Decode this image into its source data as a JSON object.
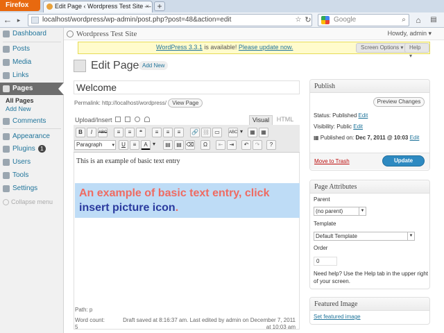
{
  "browser": {
    "firefox_label": "Firefox",
    "tab_title": "Edit Page ‹ Wordpress Test Site — Word...",
    "tab_close": "×",
    "new_tab": "+",
    "url": "localhost/wordpress/wp-admin/post.php?post=48&action=edit",
    "search_placeholder": "Google"
  },
  "admin_bar": {
    "site_title": "Wordpress Test Site",
    "howdy": "Howdy, admin ▾"
  },
  "notice": {
    "prefix": "WordPress 3.3.1",
    "middle": " is available! ",
    "link": "Please update now.",
    "screen_options": "Screen Options ▾",
    "help": "Help ▾"
  },
  "sidebar": {
    "items": [
      {
        "label": "Dashboard"
      },
      {
        "label": "Posts"
      },
      {
        "label": "Media"
      },
      {
        "label": "Links"
      },
      {
        "label": "Pages"
      },
      {
        "label": "Comments"
      },
      {
        "label": "Appearance"
      },
      {
        "label": "Plugins"
      },
      {
        "label": "Users"
      },
      {
        "label": "Tools"
      },
      {
        "label": "Settings"
      }
    ],
    "sub_items": [
      "All Pages",
      "Add New"
    ],
    "plugins_badge": "1",
    "collapse": "Collapse menu"
  },
  "page": {
    "title": "Edit Page",
    "add_new": "Add New",
    "post_title": "Welcome",
    "permalink_label": "Permalink: http://localhost/wordpress/",
    "view_page": "View Page",
    "upload_insert": "Upload/Insert",
    "tab_visual": "Visual",
    "tab_html": "HTML",
    "format_select": "Paragraph",
    "editor_text": "This is an example of basic text entry",
    "callout_line1": "An example of basic text entry, click",
    "callout_line2": "insert picture icon",
    "callout_dot": ".",
    "path": "Path: p",
    "word_count_label": "Word count:",
    "word_count": "5",
    "draft_saved": "Draft saved at 8:16:37 am. Last edited by admin on December 7, 2011 at 10:03 am"
  },
  "publish": {
    "header": "Publish",
    "preview": "Preview Changes",
    "status_label": "Status: ",
    "status_value": "Published",
    "visibility_label": "Visibility: ",
    "visibility_value": "Public",
    "published_on_label": "Published on: ",
    "published_on_value": "Dec 7, 2011 @ 10:03",
    "edit": "Edit",
    "move_trash": "Move to Trash",
    "update": "Update"
  },
  "attributes": {
    "header": "Page Attributes",
    "parent_label": "Parent",
    "parent_value": "(no parent)",
    "template_label": "Template",
    "template_value": "Default Template",
    "order_label": "Order",
    "order_value": "0",
    "help_text_1": "Need help? Use the Help tab in the upper right",
    "help_text_2": "of your screen."
  },
  "featured": {
    "header": "Featured Image",
    "set_link": "Set featured image"
  },
  "toolbar_row1": [
    "B",
    "I",
    "ABC",
    "≡",
    "≡",
    "❝",
    "≡",
    "≡",
    "≡",
    "🔗",
    "⛓",
    "▭",
    "ABC",
    "▾",
    "▦",
    "▦"
  ],
  "toolbar_row2": [
    "U",
    "≡",
    "A",
    "▾",
    "▤",
    "▤",
    "⌫",
    "Ω",
    "⇤",
    "⇥",
    "↶",
    "↷",
    "?"
  ],
  "colors": {
    "accent": "#21759b",
    "active_menu": "#6d6d6d",
    "update_btn": "#2e8ac1",
    "callout_bg": "#bedcf6"
  }
}
